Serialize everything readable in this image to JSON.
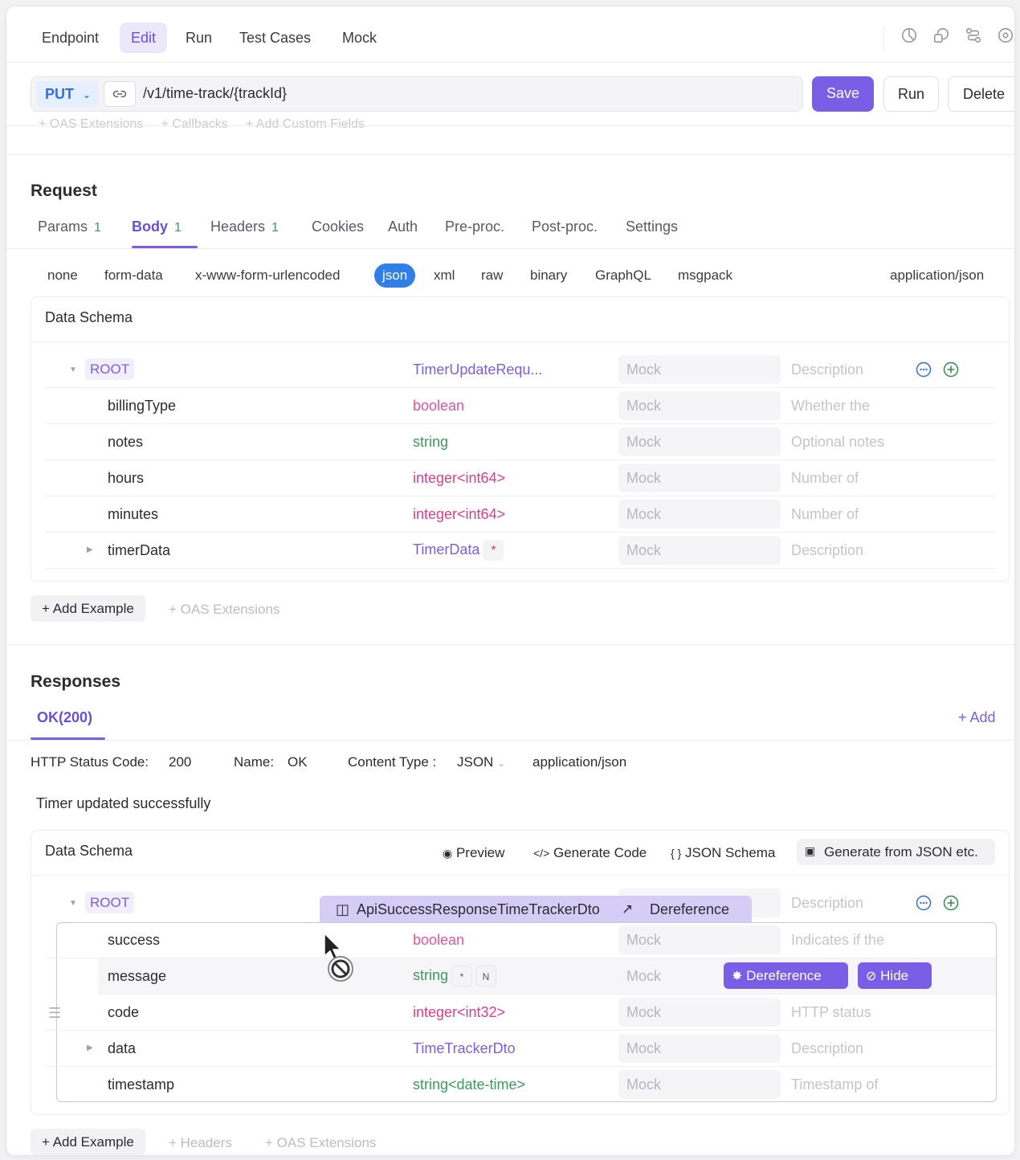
{
  "toptabs": [
    "Endpoint",
    "Edit",
    "Run",
    "Test Cases",
    "Mock"
  ],
  "active_top_tab": "Edit",
  "urlbar": {
    "method": "PUT",
    "path": "/v1/time-track/{trackId}",
    "save_label": "Save",
    "run_label": "Run",
    "delete_label": "Delete"
  },
  "ghost_row": "+ OAS Extensions     + Callbacks     + Add Custom Fields",
  "request": {
    "title": "Request",
    "tabs": [
      {
        "label": "Params",
        "count": "1"
      },
      {
        "label": "Body",
        "count": "1"
      },
      {
        "label": "Headers",
        "count": "1"
      },
      {
        "label": "Cookies",
        "count": ""
      },
      {
        "label": "Auth",
        "count": ""
      },
      {
        "label": "Pre-proc.",
        "count": ""
      },
      {
        "label": "Post-proc.",
        "count": ""
      },
      {
        "label": "Settings",
        "count": ""
      }
    ],
    "body_types": [
      "none",
      "form-data",
      "x-www-form-urlencoded",
      "json",
      "xml",
      "raw",
      "binary",
      "GraphQL",
      "msgpack"
    ],
    "content_type": "application/json",
    "schema_title": "Data Schema",
    "root_label": "ROOT",
    "root_type": "TimerUpdateRequ...",
    "mock_placeholder": "Mock",
    "root_desc": "Description",
    "fields": [
      {
        "name": "billingType",
        "type": "boolean",
        "desc": "Whether the"
      },
      {
        "name": "notes",
        "type": "string",
        "desc": "Optional notes"
      },
      {
        "name": "hours",
        "type": "integer<int64>",
        "desc": "Number of"
      },
      {
        "name": "minutes",
        "type": "integer<int64>",
        "desc": "Number of"
      },
      {
        "name": "timerData",
        "type": "TimerData",
        "desc": "Description",
        "required": "*"
      }
    ],
    "add_example": "+ Add Example",
    "oas_ext": "+ OAS Extensions"
  },
  "responses": {
    "title": "Responses",
    "tab": "OK(200)",
    "add": "+ Add",
    "status_label": "HTTP Status Code:",
    "status_value": "200",
    "name_label": "Name:",
    "name_value": "OK",
    "ctype_label": "Content Type :",
    "ctype_value": "JSON",
    "ctype_mime": "application/json",
    "description": "Timer updated successfully",
    "schema_title": "Data Schema",
    "tools": [
      "Preview",
      "Generate Code",
      "JSON Schema",
      "Generate from JSON etc."
    ],
    "root_label": "ROOT",
    "root_desc": "Description",
    "drag_ref": "ApiSuccessResponseTimeTrackerDto",
    "drag_deref": "Dereference",
    "fields": [
      {
        "name": "success",
        "type": "boolean",
        "desc": "Indicates if the"
      },
      {
        "name": "message",
        "type": "string",
        "desc": "",
        "chip1": "*",
        "chip2": "N"
      },
      {
        "name": "code",
        "type": "integer<int32>",
        "desc": "HTTP status"
      },
      {
        "name": "data",
        "type": "TimeTrackerDto",
        "desc": "Description"
      },
      {
        "name": "timestamp",
        "type": "string<date-time>",
        "desc": "Timestamp of"
      }
    ],
    "row_deref": "Dereference",
    "row_hide": "Hide",
    "add_example": "+ Add Example",
    "headers": "+ Headers",
    "oas_ext": "+ OAS Extensions"
  }
}
